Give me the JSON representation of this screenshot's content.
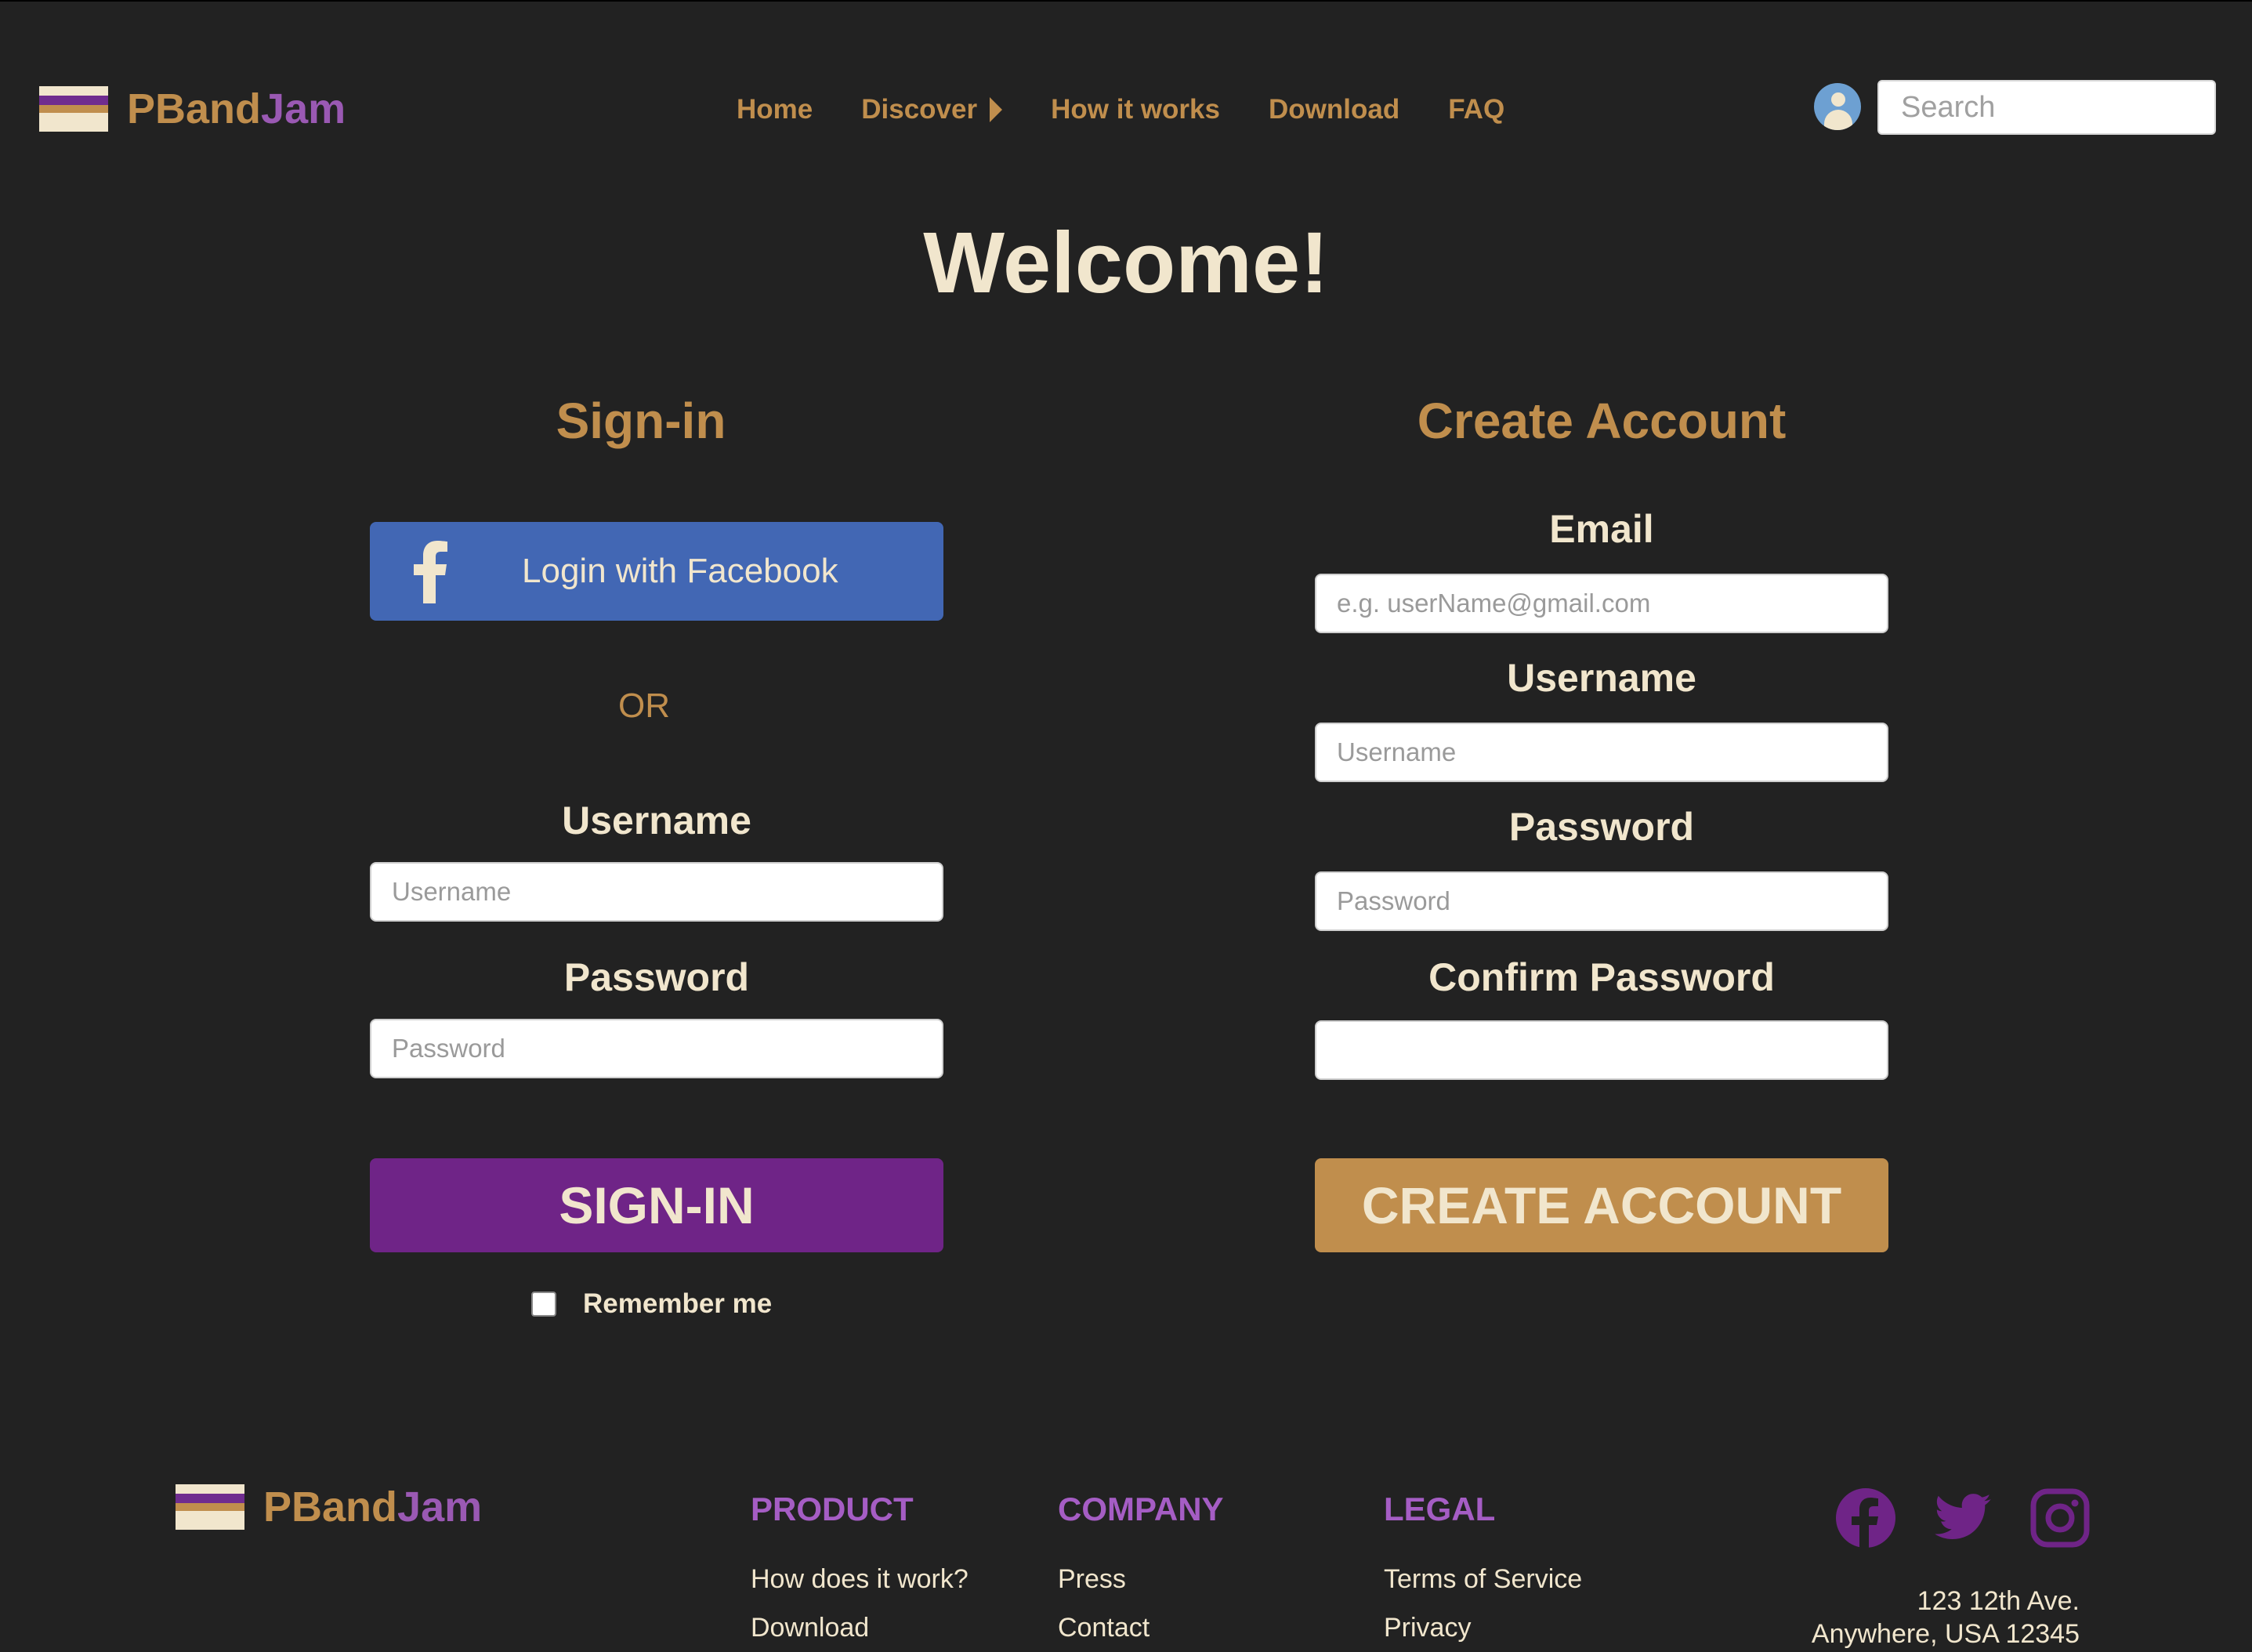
{
  "brand": {
    "name_part1": "PBand",
    "name_part2": "Jam"
  },
  "nav": {
    "items": [
      {
        "label": "Home"
      },
      {
        "label": "Discover"
      },
      {
        "label": "How it works"
      },
      {
        "label": "Download"
      },
      {
        "label": "FAQ"
      }
    ]
  },
  "search": {
    "placeholder": "Search"
  },
  "main": {
    "welcome": "Welcome!"
  },
  "signin": {
    "title": "Sign-in",
    "facebook_label": "Login with Facebook",
    "or_text": "OR",
    "username_label": "Username",
    "username_placeholder": "Username",
    "password_label": "Password",
    "password_placeholder": "Password",
    "submit_label": "SIGN-IN",
    "remember_label": "Remember me"
  },
  "create": {
    "title": "Create Account",
    "email_label": "Email",
    "email_placeholder": "e.g. userName@gmail.com",
    "username_label": "Username",
    "username_placeholder": "Username",
    "password_label": "Password",
    "password_placeholder": "Password",
    "confirm_label": "Confirm Password",
    "confirm_placeholder": "",
    "submit_label": "CREATE ACCOUNT"
  },
  "footer": {
    "columns": [
      {
        "heading": "PRODUCT",
        "links": [
          "How does it work?",
          "Download"
        ]
      },
      {
        "heading": "COMPANY",
        "links": [
          "Press",
          "Contact"
        ]
      },
      {
        "heading": "LEGAL",
        "links": [
          "Terms of Service",
          "Privacy"
        ]
      }
    ],
    "social_icons": [
      "facebook-icon",
      "twitter-icon",
      "instagram-icon"
    ],
    "address_line1": "123 12th Ave.",
    "address_line2": "Anywhere, USA 12345"
  },
  "colors": {
    "background": "#222222",
    "gold": "#c08e4d",
    "purple": "#6f2487",
    "light_purple": "#a55dc4",
    "cream": "#f1e6cd",
    "facebook_blue": "#4267b4"
  }
}
